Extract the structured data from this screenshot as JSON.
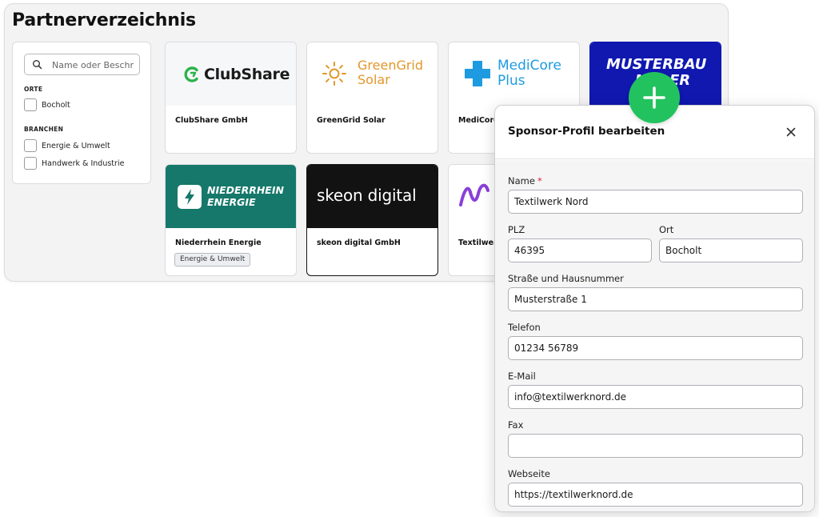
{
  "directory": {
    "title": "Partnerverzeichnis",
    "search": {
      "placeholder": "Name oder Beschr",
      "value": ""
    },
    "filters": {
      "orte_heading": "ORTE",
      "orte": [
        "Bocholt"
      ],
      "branchen_heading": "BRANCHEN",
      "branchen": [
        "Energie & Umwelt",
        "Handwerk & Industrie"
      ]
    },
    "cards": [
      {
        "name": "ClubShare GmbH",
        "logo": "ClubShare",
        "logo_icon": "clubshare-c-icon",
        "banner_color": "#f6f7f8",
        "accent": "#2bb34a"
      },
      {
        "name": "GreenGrid Solar",
        "logo_line1": "GreenGrid",
        "logo_line2": "Solar",
        "logo_icon": "sun-icon",
        "banner_color": "#ffffff",
        "accent": "#e2972b"
      },
      {
        "name": "MediCore",
        "logo_line1": "MediCore",
        "logo_line2": "Plus",
        "logo_icon": "medical-cross-icon",
        "banner_color": "#ffffff",
        "accent": "#1e9be0"
      },
      {
        "name": "",
        "logo_line1": "MUSTERBAU",
        "logo_line2": "M    ER",
        "banner_color": "#1018b0"
      },
      {
        "name": "Niederrhein Energie",
        "logo_line1": "NIEDERRHEIN",
        "logo_line2": "ENERGIE",
        "logo_icon": "lightning-icon",
        "banner_color": "#15786a",
        "tag": "Energie & Umwelt"
      },
      {
        "name": "skeon digital GmbH",
        "logo": "skeon digital",
        "banner_color": "#121212"
      },
      {
        "name": "Textilwer",
        "logo_icon": "wave-icon",
        "banner_color": "#ffffff",
        "accent": "#8a3fd9"
      }
    ]
  },
  "modal": {
    "title": "Sponsor-Profil bearbeiten",
    "required_marker": "*",
    "fields": {
      "name": {
        "label": "Name",
        "value": "Textilwerk Nord"
      },
      "plz": {
        "label": "PLZ",
        "value": "46395"
      },
      "ort": {
        "label": "Ort",
        "value": "Bocholt"
      },
      "strasse": {
        "label": "Straße und Hausnummer",
        "value": "Musterstraße 1"
      },
      "telefon": {
        "label": "Telefon",
        "value": "01234 56789"
      },
      "email": {
        "label": "E-Mail",
        "value": "info@textilwerknord.de"
      },
      "fax": {
        "label": "Fax",
        "value": ""
      },
      "webseite": {
        "label": "Webseite",
        "value": "https://textilwerknord.de"
      }
    }
  },
  "colors": {
    "add_button": "#22c35e",
    "required": "#d0283a"
  }
}
